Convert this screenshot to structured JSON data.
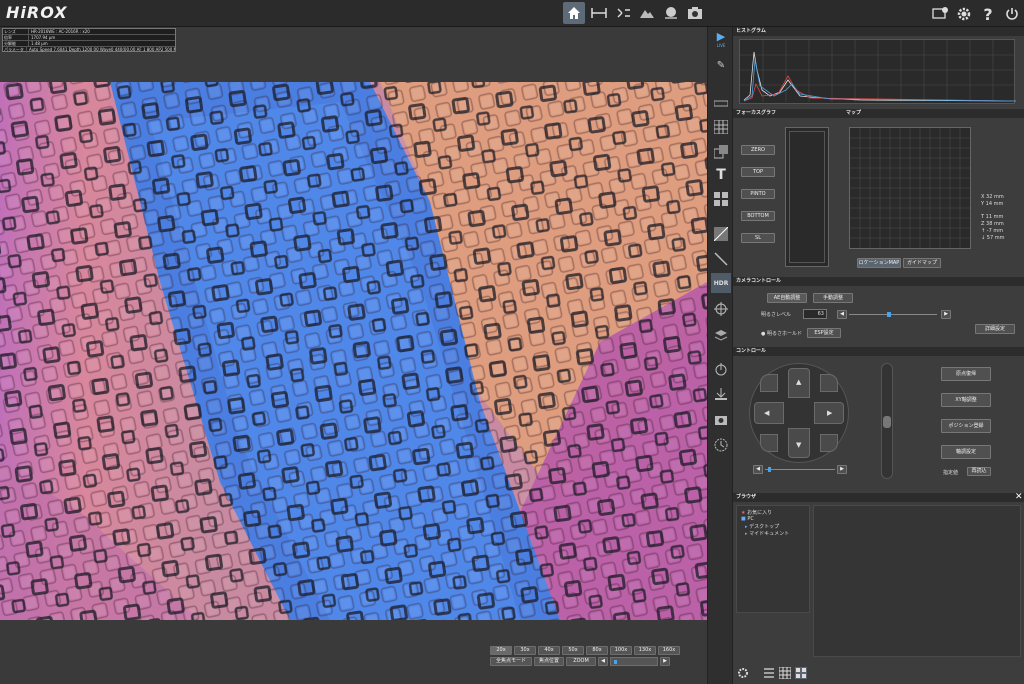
{
  "app": {
    "logo": "HiROX"
  },
  "info": {
    "rows": [
      {
        "key": "レンズ",
        "value": "HR-2016WE : AC-2016R : x20"
      },
      {
        "key": "倍率",
        "value": "1707.94 μm"
      },
      {
        "key": "分解能",
        "value": "1.48 μm"
      },
      {
        "key": "パラメータ",
        "value": "Auto Speed 7.6041 Depth 1200 00 Wave0 440(00.00 AF 1 800 AP2 500 MF 500"
      }
    ]
  },
  "zoom": {
    "levels": [
      "20x",
      "30x",
      "40x",
      "50x",
      "80x",
      "100x",
      "130x",
      "160x"
    ],
    "selected": "20x",
    "row2": [
      "全焦点モード",
      "焦点位置",
      "ZOOM"
    ]
  },
  "histogram": {
    "title": "ヒストグラム"
  },
  "focus": {
    "title": "フォーカスグラフ",
    "map_title": "マップ",
    "buttons": [
      "ZERO",
      "TOP",
      "PINTO",
      "BOTTOM",
      "SL"
    ],
    "readout": [
      "X  32  mm",
      "Y  14  mm",
      "T  11  mm",
      "Z  38  mm",
      "↑  -7  mm",
      "↓  57  mm"
    ],
    "map_buttons": [
      "ロケーションMAP",
      "ガイドマップ"
    ]
  },
  "camera": {
    "title": "カメラコントロール",
    "mode_buttons": [
      "AE自動調整",
      "手動調整"
    ],
    "brightness_label": "明るさレベル",
    "brightness_value": "63",
    "brightness_level": 0.45,
    "option_label": "● 明るさホールド",
    "option_button": "ESP設定",
    "detail_button": "詳細設定"
  },
  "control": {
    "title": "コントロール",
    "buttons": [
      "原点復帰",
      "XY軸調整",
      "ポジション登録",
      "軸調設定"
    ],
    "bottom_labels": [
      "指定値",
      "再読込"
    ],
    "speed_level": 0.05
  },
  "browser": {
    "title": "ブラウザ",
    "tree": [
      "お気に入り",
      "PC",
      "デスクトップ",
      "マイドキュメント"
    ]
  },
  "colors": {
    "accent": "#5d6b78",
    "panel": "#3d3d3d"
  }
}
